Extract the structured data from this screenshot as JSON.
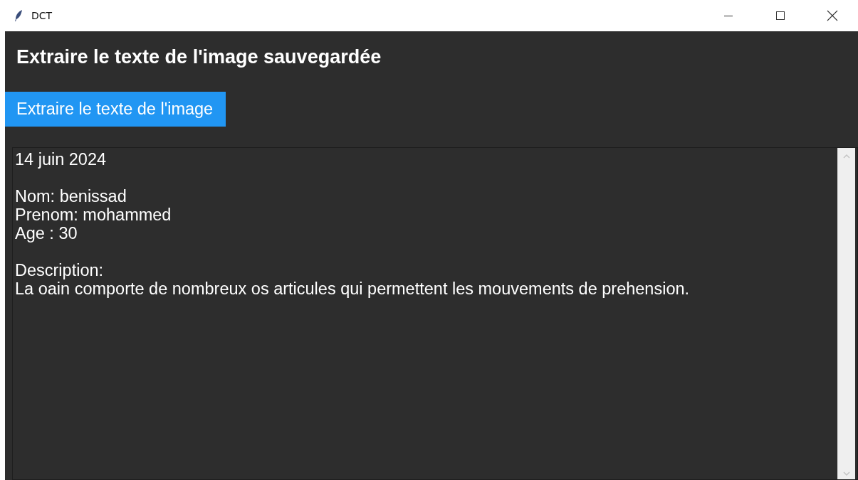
{
  "window": {
    "title": "DCT"
  },
  "heading": "Extraire le texte de l'image sauvegardée",
  "extract_button": {
    "label": "Extraire le texte de l'image"
  },
  "text_area": {
    "paragraphs": [
      [
        "14 juin 2024"
      ],
      [
        "Nom: benissad",
        "Prenom: mohammed",
        "Age : 30"
      ],
      [
        "Description:",
        "La oain comporte de nombreux os articules qui permettent les mouvements de prehension."
      ]
    ]
  }
}
